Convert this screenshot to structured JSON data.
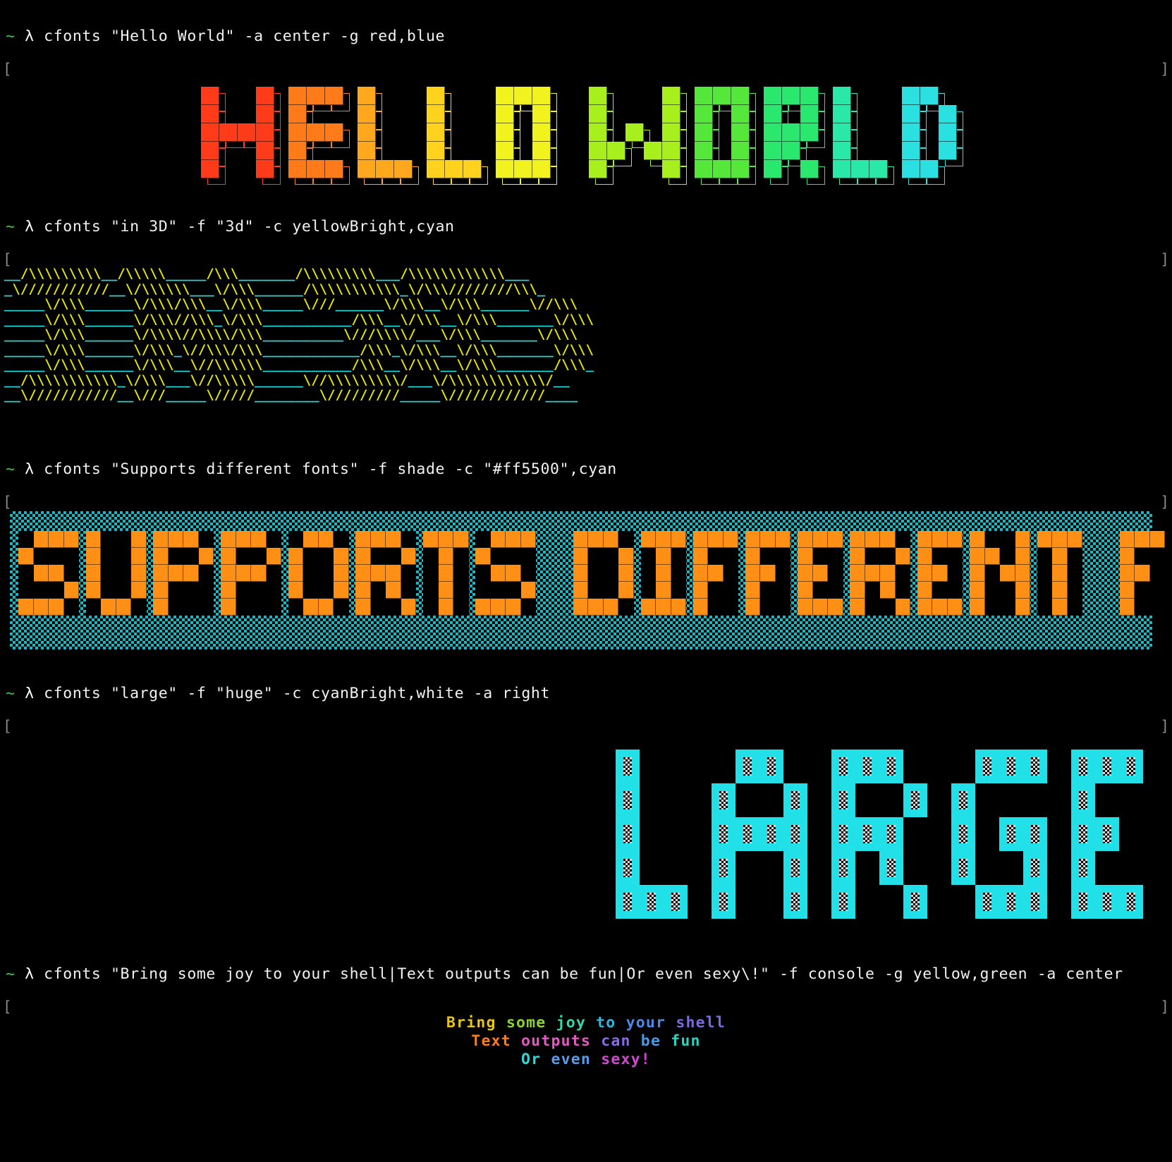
{
  "terminal": {
    "background": "#000000",
    "foreground": "#f2f2f2",
    "prompt_symbol": "~",
    "prompt_lambda": "λ",
    "prompt_color": "#2ecc40",
    "bracket_open": "[",
    "bracket_close": "]",
    "bracket_color": "#8a8a8a"
  },
  "blocks": [
    {
      "id": "hello-world",
      "command": "~ λ cfonts \"Hello World\" -a center -g red,blue",
      "command_parts": {
        "tilde": "~",
        "lambda": "λ",
        "rest": " cfonts \"Hello World\" -a center -g red,blue"
      },
      "cli": {
        "program": "cfonts",
        "text": "Hello World",
        "flags": [
          {
            "flag": "-a",
            "value": "center"
          },
          {
            "flag": "-g",
            "value": "red,blue"
          }
        ]
      },
      "render": {
        "font": "block",
        "align": "center",
        "gradient": [
          "red",
          "blue"
        ],
        "text": "HELLO WORLD",
        "letter_colors": [
          "#ff3b19",
          "#ff7b1a",
          "#ffa81e",
          "#ffd21e",
          "#f2f21e",
          "#a8ef1e",
          "#55e83a",
          "#2ae86e",
          "#2ae8a8",
          "#2ae0e0",
          "#2aa8ff",
          "#3a55f0"
        ]
      }
    },
    {
      "id": "in-3d",
      "command": "~ λ cfonts \"in 3D\" -f \"3d\" -c yellowBright,cyan",
      "command_parts": {
        "tilde": "~",
        "lambda": "λ",
        "rest": " cfonts \"in 3D\" -f \"3d\" -c yellowBright,cyan"
      },
      "cli": {
        "program": "cfonts",
        "text": "in 3D",
        "flags": [
          {
            "flag": "-f",
            "value": "3d"
          },
          {
            "flag": "-c",
            "value": "yellowBright,cyan"
          }
        ]
      },
      "render": {
        "font": "3d",
        "colors": [
          "yellowBright",
          "cyan"
        ],
        "color_hex": {
          "fore": "#e8e800",
          "shadow": "#2ad4d4"
        },
        "text": "in 3D",
        "ascii_rows": [
          "__/\\\\\\\\\\\\\\\\\\__/\\\\\\\\\\_____/\\\\\\_______/\\\\\\\\\\\\\\\\\\___/\\\\\\\\\\\\\\\\\\\\\\\\___",
          "_\\///////////__\\/\\\\\\\\\\\\___\\/\\\\\\______/\\\\\\\\\\\\\\\\\\\\\\_\\/\\\\\\////////\\\\\\_",
          "_____\\/\\\\\\______\\/\\\\\\/\\\\\\__\\/\\\\\\_____\\///______\\/\\\\\\__\\/\\\\\\______\\//\\\\\\",
          "_____\\/\\\\\\______\\/\\\\\\//\\\\\\_\\/\\\\\\___________/\\\\\\__\\/\\\\\\__\\/\\\\\\_______\\/\\\\\\",
          "_____\\/\\\\\\______\\/\\\\\\\\//\\\\\\\\/\\\\\\__________\\///\\\\\\\\/___\\/\\\\\\_______\\/\\\\\\",
          "_____\\/\\\\\\______\\/\\\\\\_\\//\\\\\\/\\\\\\____________/\\\\\\_\\/\\\\\\__\\/\\\\\\_______\\/\\\\\\",
          "_____\\/\\\\\\______\\/\\\\\\__\\//\\\\\\\\\\\\___________/\\\\\\__\\/\\\\\\__\\/\\\\\\_______/\\\\\\_",
          "__/\\\\\\\\\\\\\\\\\\\\\\_\\/\\\\\\___\\//\\\\\\\\\\______\\//\\\\\\\\\\\\\\\\\\/___\\/\\\\\\\\\\\\\\\\\\\\\\\\/__",
          "__\\///////////__\\///_____\\/////________\\/////////_____\\////////////____"
        ]
      }
    },
    {
      "id": "supports-different-fonts",
      "command": "~ λ cfonts \"Supports different fonts\" -f shade -c \"#ff5500\",cyan",
      "command_parts": {
        "tilde": "~",
        "lambda": "λ",
        "rest": " cfonts \"Supports different fonts\" -f shade -c \"#ff5500\",cyan"
      },
      "cli": {
        "program": "cfonts",
        "text": "Supports different fonts",
        "flags": [
          {
            "flag": "-f",
            "value": "shade"
          },
          {
            "flag": "-c",
            "value": "\"#ff5500\",cyan"
          }
        ]
      },
      "render": {
        "font": "shade",
        "text": "SUPPORTS DIFFERENT FONTS",
        "fore_hex": "#ff9015",
        "shade_hex": "#16b8c4",
        "words": [
          "SUPPORTS",
          "DIFFERENT",
          "FONTS"
        ]
      }
    },
    {
      "id": "large",
      "command": "~ λ cfonts \"large\" -f \"huge\" -c cyanBright,white -a right",
      "command_parts": {
        "tilde": "~",
        "lambda": "λ",
        "rest": " cfonts \"large\" -f \"huge\" -c cyanBright,white -a right"
      },
      "cli": {
        "program": "cfonts",
        "text": "large",
        "flags": [
          {
            "flag": "-f",
            "value": "huge"
          },
          {
            "flag": "-c",
            "value": "cyanBright,white"
          },
          {
            "flag": "-a",
            "value": "right"
          }
        ]
      },
      "render": {
        "font": "huge",
        "align": "right",
        "text": "LARGE",
        "outline_hex": "#22e0e8",
        "fill_hex": "#d8d8d8"
      }
    },
    {
      "id": "bring-some-joy",
      "command": "~ λ cfonts \"Bring some joy to your shell|Text outputs can be fun|Or even sexy\\!\" -f console -g yellow,green -a center",
      "command_parts": {
        "tilde": "~",
        "lambda": "λ",
        "rest": " cfonts \"Bring some joy to your shell|Text outputs can be fun|Or even sexy\\!\" -f console -g yellow,green -a center"
      },
      "cli": {
        "program": "cfonts",
        "text": "Bring some joy to your shell|Text outputs can be fun|Or even sexy\\!",
        "flags": [
          {
            "flag": "-f",
            "value": "console"
          },
          {
            "flag": "-g",
            "value": "yellow,green"
          },
          {
            "flag": "-a",
            "value": "center"
          }
        ]
      },
      "render": {
        "font": "console",
        "align": "center",
        "gradient": [
          "yellow",
          "green"
        ],
        "lines": [
          {
            "text": "Bring some joy to your shell",
            "words": [
              {
                "t": "Bring",
                "c": "#e8c21e"
              },
              {
                "t": "some",
                "c": "#8ad42e"
              },
              {
                "t": "joy",
                "c": "#3ad4a8"
              },
              {
                "t": "to",
                "c": "#2ab8e0"
              },
              {
                "t": "your",
                "c": "#4a8ae8"
              },
              {
                "t": "shell",
                "c": "#7a6ae0"
              }
            ]
          },
          {
            "text": "Text outputs can be fun",
            "words": [
              {
                "t": "Text",
                "c": "#ff7a1a"
              },
              {
                "t": "outputs",
                "c": "#e05ac0"
              },
              {
                "t": "can",
                "c": "#8a6ae8"
              },
              {
                "t": "be",
                "c": "#4a9ae8"
              },
              {
                "t": "fun",
                "c": "#2ad4c0"
              }
            ]
          },
          {
            "text": "Or even sexy!",
            "words": [
              {
                "t": "Or",
                "c": "#3ad4d4"
              },
              {
                "t": "even",
                "c": "#5a9ae8"
              },
              {
                "t": "sexy!",
                "c": "#d04ad0"
              }
            ]
          }
        ]
      }
    }
  ]
}
